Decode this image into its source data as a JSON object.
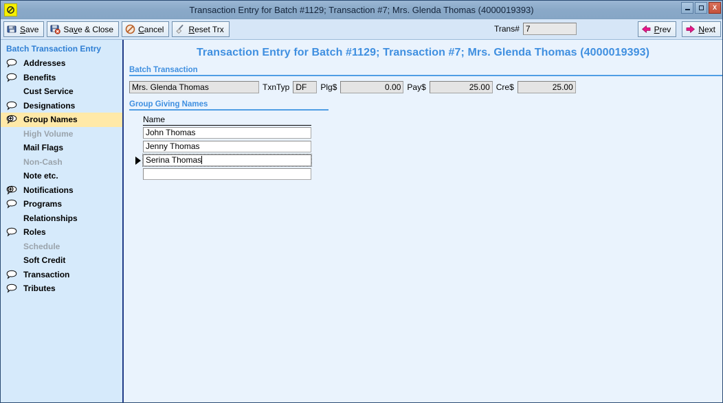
{
  "window": {
    "title": "Transaction Entry for Batch #1129; Transaction #7; Mrs. Glenda Thomas (4000019393)",
    "app_icon": "prohibited-circle-icon",
    "controls": {
      "minimize": "minimize-icon",
      "maximize": "maximize-icon",
      "close": "X"
    }
  },
  "toolbar": {
    "buttons": [
      {
        "label": "Save",
        "accel_index": 0,
        "icon": "save-disk-icon"
      },
      {
        "label": "Save & Close",
        "accel_index": 2,
        "icon": "save-close-icon"
      },
      {
        "label": "Cancel",
        "accel_index": 0,
        "icon": "cancel-icon"
      },
      {
        "label": "Reset Trx",
        "accel_index": 0,
        "icon": "reset-broom-icon"
      }
    ],
    "trans_label": "Trans#",
    "trans_value": "7",
    "nav": [
      {
        "label": "Prev",
        "accel_index": 1,
        "icon": "arrow-left-icon"
      },
      {
        "label": "Next",
        "accel_index": 0,
        "icon": "arrow-right-icon"
      }
    ]
  },
  "sidebar": {
    "title": "Batch Transaction Entry",
    "items": [
      {
        "label": "Addresses",
        "icon": "speech-bubble-icon",
        "state": "normal"
      },
      {
        "label": "Benefits",
        "icon": "speech-bubble-icon",
        "state": "normal"
      },
      {
        "label": "Cust Service",
        "icon": "none",
        "state": "normal"
      },
      {
        "label": "Designations",
        "icon": "speech-bubble-icon",
        "state": "normal"
      },
      {
        "label": "Group Names",
        "icon": "plus-circle-icon",
        "state": "selected"
      },
      {
        "label": "High Volume",
        "icon": "none",
        "state": "disabled"
      },
      {
        "label": "Mail Flags",
        "icon": "none",
        "state": "normal"
      },
      {
        "label": "Non-Cash",
        "icon": "none",
        "state": "disabled"
      },
      {
        "label": "Note etc.",
        "icon": "none",
        "state": "normal"
      },
      {
        "label": "Notifications",
        "icon": "plus-circle-icon",
        "state": "normal"
      },
      {
        "label": "Programs",
        "icon": "speech-bubble-icon",
        "state": "normal"
      },
      {
        "label": "Relationships",
        "icon": "none",
        "state": "normal"
      },
      {
        "label": "Roles",
        "icon": "speech-bubble-icon",
        "state": "normal"
      },
      {
        "label": "Schedule",
        "icon": "none",
        "state": "disabled"
      },
      {
        "label": "Soft Credit",
        "icon": "none",
        "state": "normal"
      },
      {
        "label": "Transaction",
        "icon": "speech-bubble-icon",
        "state": "normal"
      },
      {
        "label": "Tributes",
        "icon": "speech-bubble-icon",
        "state": "normal"
      }
    ]
  },
  "content": {
    "heading": "Transaction Entry for Batch #1129; Transaction #7; Mrs. Glenda Thomas (4000019393)",
    "batch_transaction": {
      "section_title": "Batch Transaction",
      "donor_name": "Mrs. Glenda Thomas",
      "txntyp_label": "TxnTyp",
      "txntyp_value": "DF",
      "plg_label": "Plg$",
      "plg_value": "0.00",
      "pay_label": "Pay$",
      "pay_value": "25.00",
      "cre_label": "Cre$",
      "cre_value": "25.00"
    },
    "group_giving_names": {
      "section_title": "Group Giving Names",
      "column_header": "Name",
      "rows": [
        {
          "name": "John Thomas",
          "active": false
        },
        {
          "name": "Jenny Thomas",
          "active": false
        },
        {
          "name": "Serina Thomas",
          "active": true
        },
        {
          "name": "",
          "active": false
        }
      ]
    }
  },
  "colors": {
    "title_bar": "#8aa9c8",
    "accent_blue": "#3f8fe0",
    "sidebar_bg": "#d6eafb",
    "sidebar_border": "#1f3a87",
    "content_bg": "#eaf3fd",
    "selected_row": "#ffe9a8",
    "toolbar_bg": "#d6e6f7",
    "nav_arrow": "#e8178a"
  }
}
